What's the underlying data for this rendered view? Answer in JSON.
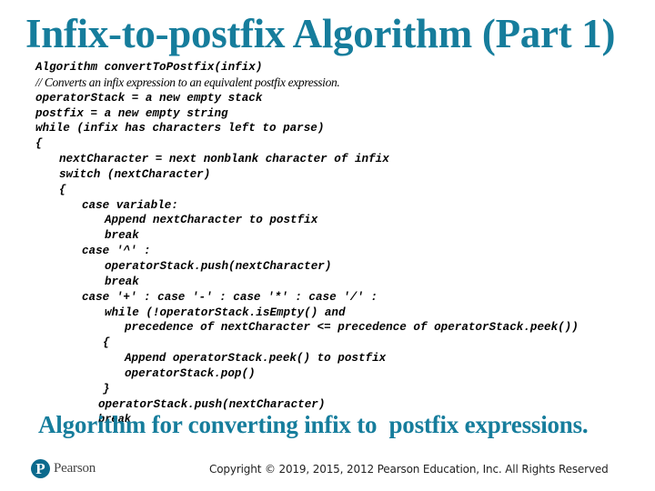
{
  "slide": {
    "title": "Infix-to-postfix Algorithm (Part 1)",
    "colors": {
      "title": "#167d9c",
      "caption": "#167d9c",
      "code": "#000000",
      "logo": "#0b6a8d"
    },
    "code_lines": [
      {
        "indent": 0,
        "text": "Algorithm convertToPostfix(infix)"
      },
      {
        "indent": 0,
        "text": "// Converts an infix expression to an equivalent postfix expression.",
        "kind": "comment"
      },
      {
        "indent": 0,
        "text": "operatorStack = a new empty stack"
      },
      {
        "indent": 0,
        "text": "postfix = a new empty string"
      },
      {
        "indent": 0,
        "text": "while (infix has characters left to parse)"
      },
      {
        "indent": 0,
        "text": "{"
      },
      {
        "indent": 1,
        "text": "nextCharacter = next nonblank character of infix"
      },
      {
        "indent": 1,
        "text": "switch (nextCharacter)"
      },
      {
        "indent": 1,
        "text": "{"
      },
      {
        "indent": 2,
        "text": "case variable:"
      },
      {
        "indent": 3,
        "text": "Append nextCharacter to postfix"
      },
      {
        "indent": 3,
        "text": "break"
      },
      {
        "indent": 2,
        "text": "case '^' :"
      },
      {
        "indent": 3,
        "text": "operatorStack.push(nextCharacter)"
      },
      {
        "indent": 3,
        "text": "break"
      },
      {
        "indent": 2,
        "text": "case '+' : case '-' : case '*' : case '/' :"
      },
      {
        "indent": 3,
        "text": "while (!operatorStack.isEmpty() and"
      },
      {
        "indent": 4,
        "text": "precedence of nextCharacter <= precedence of operatorStack.peek())"
      },
      {
        "indent": 3,
        "text": "{"
      },
      {
        "indent": 4,
        "text": "Append operatorStack.peek() to postfix"
      },
      {
        "indent": 4,
        "text": "operatorStack.pop()"
      },
      {
        "indent": 3,
        "text": "}"
      },
      {
        "indent": 3,
        "text": "operatorStack.push(nextCharacter)"
      },
      {
        "indent": 3,
        "text": "break",
        "kind": "small"
      }
    ],
    "caption": "Algorithm for converting infix to  postfix expressions.",
    "footer": {
      "logo_icon": "pearson-p-logo-icon",
      "logo_letter": "P",
      "logo_text": "Pearson",
      "copyright": "Copyright © 2019, 2015, 2012 Pearson Education, Inc. All Rights Reserved"
    }
  }
}
